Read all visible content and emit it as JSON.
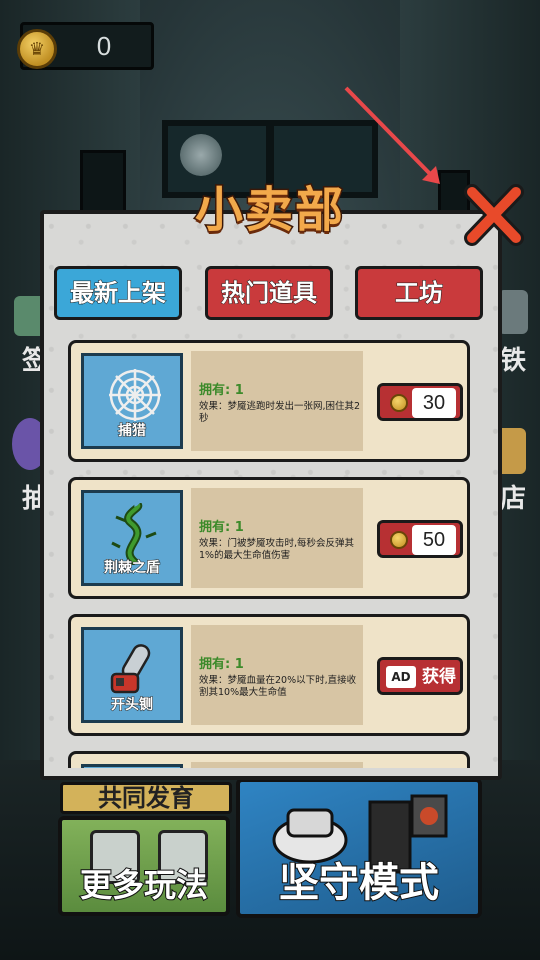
{
  "currency": {
    "count": "0"
  },
  "shop": {
    "title": "小卖部",
    "tabs": [
      {
        "label": "最新上架",
        "active": true
      },
      {
        "label": "热门道具",
        "active": false
      },
      {
        "label": "工坊",
        "active": false
      }
    ],
    "items": [
      {
        "name": "捕猎",
        "icon": "spider-web-icon",
        "owned": "拥有: 1",
        "description": "效果：梦魇逃跑时发出一张网,困住其2秒",
        "action": "price",
        "price": "30"
      },
      {
        "name": "荆棘之盾",
        "icon": "thorn-vine-icon",
        "owned": "拥有: 1",
        "description": "效果：门被梦魇攻击时,每秒会反弹其1%的最大生命值伤害",
        "action": "price",
        "price": "50"
      },
      {
        "name": "开头铡",
        "icon": "chainsaw-icon",
        "owned": "拥有: 1",
        "description": "效果：梦魇血量在20%以下时,直接收割其10%最大生命值",
        "action": "ad",
        "ad_tag": "AD",
        "ad_label": "获得"
      }
    ]
  },
  "menu": {
    "coop_label": "共同发育",
    "more_label": "更多玩法",
    "defend_label": "坚守模式"
  },
  "side_fragments": {
    "left_top": "签",
    "left_bottom": "抽",
    "right_top": "铁",
    "right_bottom": "店"
  },
  "colors": {
    "tab_active": "#3ba7d8",
    "tab_inactive": "#c93a3c",
    "title": "#f2a94b",
    "close": "#e84a2a"
  }
}
